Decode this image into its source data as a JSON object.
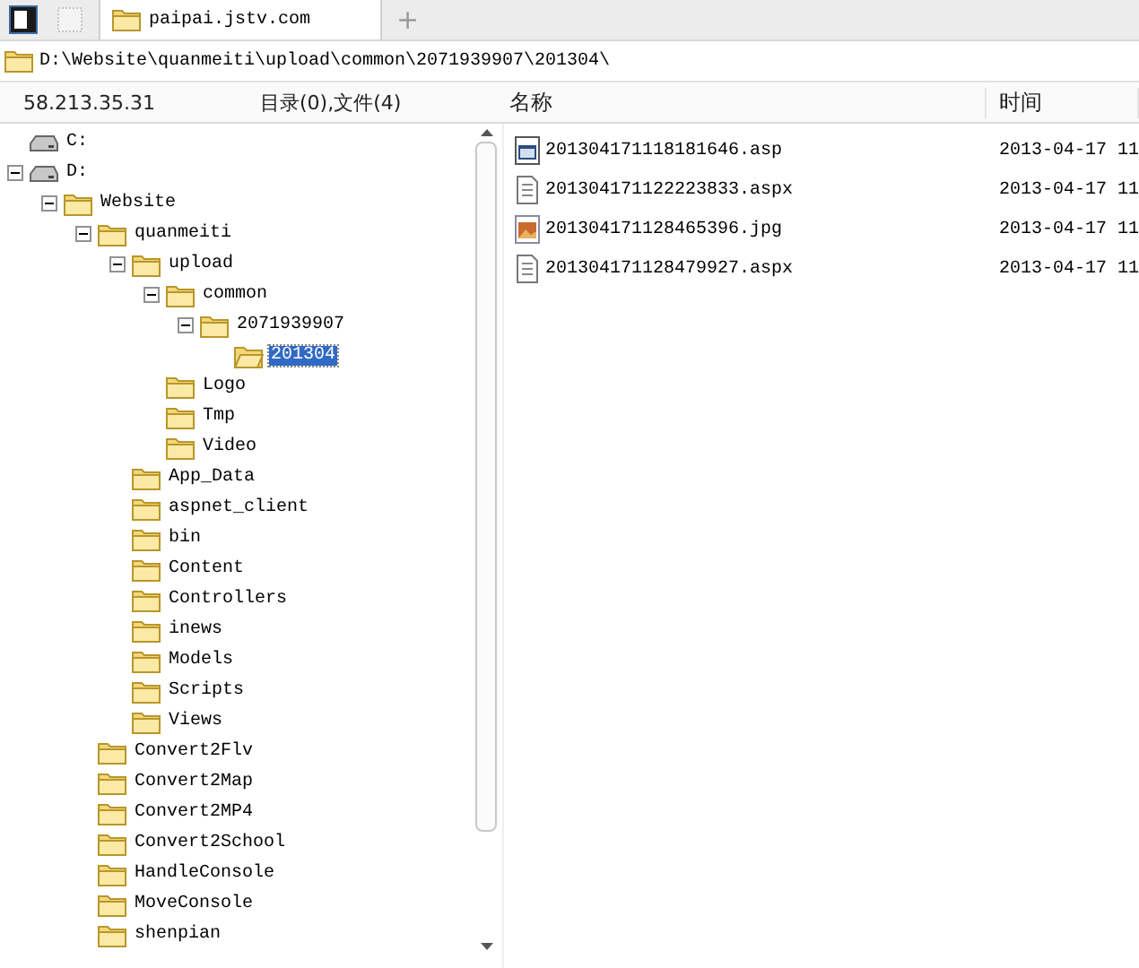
{
  "tabs": [
    {
      "label": "paipai.jstv.com",
      "selected": true
    }
  ],
  "new_tab": "+",
  "path": "D:\\Website\\quanmeiti\\upload\\common\\2071939907\\201304\\",
  "host": "58.213.35.31",
  "summary": "目录(0),文件(4)",
  "tree": [
    {
      "name": "C:",
      "kind": "drive",
      "selected": false
    },
    {
      "name": "D:",
      "kind": "drive",
      "expanded": true,
      "selected": false,
      "children": [
        {
          "name": "Website",
          "kind": "folder",
          "expanded": true,
          "selected": false,
          "children": [
            {
              "name": "quanmeiti",
              "kind": "folder",
              "expanded": true,
              "selected": false,
              "children": [
                {
                  "name": "upload",
                  "kind": "folder",
                  "expanded": true,
                  "selected": false,
                  "children": [
                    {
                      "name": "common",
                      "kind": "folder",
                      "expanded": true,
                      "selected": false,
                      "children": [
                        {
                          "name": "2071939907",
                          "kind": "folder",
                          "expanded": true,
                          "selected": false,
                          "children": [
                            {
                              "name": "201304",
                              "kind": "folder",
                              "selected": true
                            }
                          ]
                        }
                      ]
                    },
                    {
                      "name": "Logo",
                      "kind": "folder",
                      "selected": false
                    },
                    {
                      "name": "Tmp",
                      "kind": "folder",
                      "selected": false
                    },
                    {
                      "name": "Video",
                      "kind": "folder",
                      "selected": false
                    }
                  ]
                },
                {
                  "name": "App_Data",
                  "kind": "folder",
                  "selected": false
                },
                {
                  "name": "aspnet_client",
                  "kind": "folder",
                  "selected": false
                },
                {
                  "name": "bin",
                  "kind": "folder",
                  "selected": false
                },
                {
                  "name": "Content",
                  "kind": "folder",
                  "selected": false
                },
                {
                  "name": "Controllers",
                  "kind": "folder",
                  "selected": false
                },
                {
                  "name": "inews",
                  "kind": "folder",
                  "selected": false
                },
                {
                  "name": "Models",
                  "kind": "folder",
                  "selected": false
                },
                {
                  "name": "Scripts",
                  "kind": "folder",
                  "selected": false
                },
                {
                  "name": "Views",
                  "kind": "folder",
                  "selected": false
                }
              ]
            },
            {
              "name": "Convert2Flv",
              "kind": "folder",
              "selected": false
            },
            {
              "name": "Convert2Map",
              "kind": "folder",
              "selected": false
            },
            {
              "name": "Convert2MP4",
              "kind": "folder",
              "selected": false
            },
            {
              "name": "Convert2School",
              "kind": "folder",
              "selected": false
            },
            {
              "name": "HandleConsole",
              "kind": "folder",
              "selected": false
            },
            {
              "name": "MoveConsole",
              "kind": "folder",
              "selected": false
            },
            {
              "name": "shenpian",
              "kind": "folder",
              "selected": false
            }
          ]
        }
      ]
    }
  ],
  "columns": [
    "名称",
    "时间"
  ],
  "files": [
    {
      "name": "201304171118181646.asp",
      "kind": "asp",
      "time": "2013-04-17 11"
    },
    {
      "name": "201304171122223833.aspx",
      "kind": "aspx",
      "time": "2013-04-17 11"
    },
    {
      "name": "201304171128465396.jpg",
      "kind": "jpg",
      "time": "2013-04-17 11"
    },
    {
      "name": "201304171128479927.aspx",
      "kind": "aspx",
      "time": "2013-04-17 11"
    }
  ]
}
